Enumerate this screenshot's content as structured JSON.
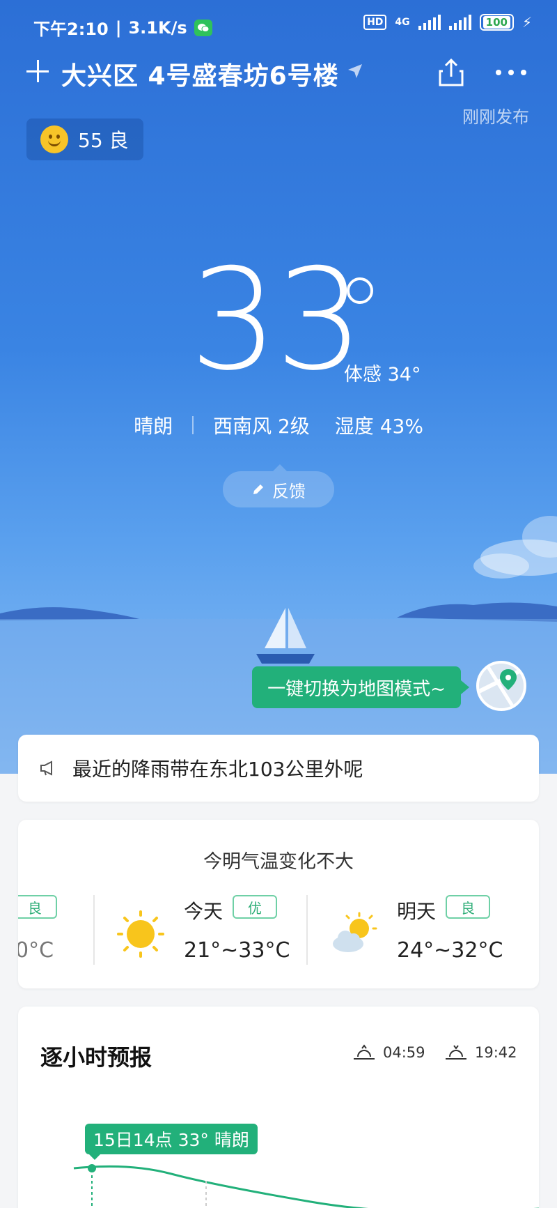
{
  "status": {
    "time": "下午2:10",
    "speed": "3.1K/s",
    "hd": "HD",
    "network": "4G",
    "battery": "100"
  },
  "header": {
    "location": "大兴区 4号盛春坊6号楼",
    "published": "刚刚发布"
  },
  "aqi": {
    "label": "55 良"
  },
  "current": {
    "temp": "33",
    "feels": "体感 34°",
    "condition": "晴朗",
    "wind": "西南风 2级",
    "humidity": "湿度 43%"
  },
  "feedback": "反馈",
  "map_tip": "一键切换为地图模式~",
  "notice": "最近的降雨带在东北103公里外呢",
  "daily": {
    "title": "今明气温变化不大",
    "prev": {
      "badge": "良",
      "range": "0°C"
    },
    "today": {
      "label": "今天",
      "badge": "优",
      "range": "21°~33°C"
    },
    "tomorrow": {
      "label": "明天",
      "badge": "良",
      "range": "24°~32°C"
    }
  },
  "hourly": {
    "title": "逐小时预报",
    "sunrise": "04:59",
    "sunset": "19:42",
    "tag": "15日14点 33° 晴朗"
  },
  "colors": {
    "accent": "#22b07a",
    "sky_top": "#2c6fd6",
    "sky_bottom": "#8cc0f4"
  }
}
